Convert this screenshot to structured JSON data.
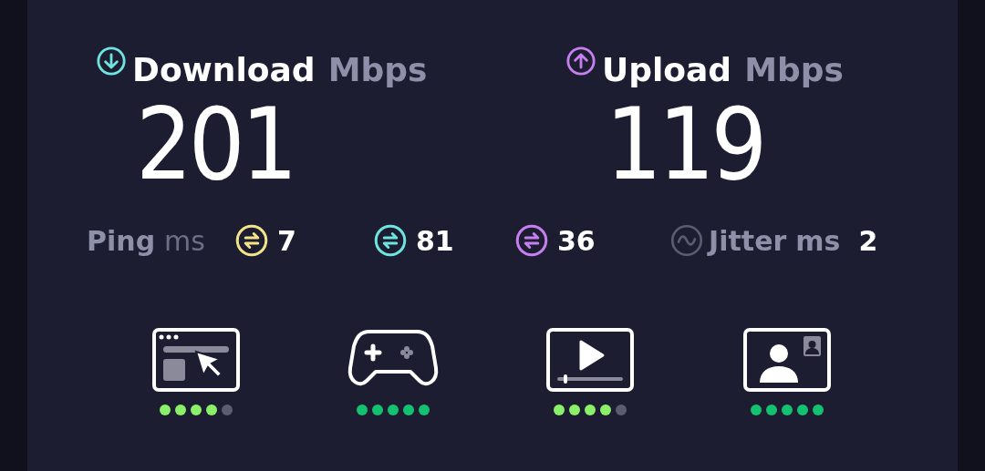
{
  "download": {
    "label": "Download",
    "unit": "Mbps",
    "value": "201"
  },
  "upload": {
    "label": "Upload",
    "unit": "Mbps",
    "value": "119"
  },
  "ping": {
    "label": "Ping",
    "unit": "ms",
    "readings": [
      {
        "color": "#f3e38a",
        "value": "7"
      },
      {
        "color": "#6fe3e0",
        "value": "81"
      },
      {
        "color": "#c77ff0",
        "value": "36"
      }
    ]
  },
  "jitter": {
    "label": "Jitter",
    "unit": "ms",
    "value": "2"
  },
  "activities": [
    {
      "kind": "browsing",
      "stars": 4
    },
    {
      "kind": "gaming",
      "stars": 5
    },
    {
      "kind": "video",
      "stars": 4
    },
    {
      "kind": "video-call",
      "stars": 5
    }
  ]
}
